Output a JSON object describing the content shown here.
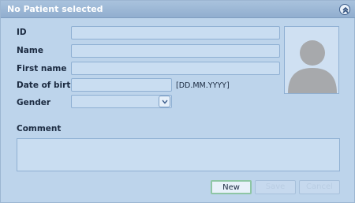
{
  "window": {
    "title": "No Patient selected"
  },
  "form": {
    "id_label": "ID",
    "name_label": "Name",
    "first_name_label": "First name",
    "dob_label": "Date of birth",
    "dob_format_hint": "[DD.MM.YYYY]",
    "gender_label": "Gender",
    "comment_label": "Comment",
    "id_value": "",
    "name_value": "",
    "first_name_value": "",
    "dob_value": "",
    "gender_value": "",
    "comment_value": ""
  },
  "buttons": {
    "new_label": "New",
    "save_label": "Save",
    "cancel_label": "Cancel"
  },
  "icons": {
    "collapse": "double-chevron-up-icon",
    "gender_dropdown": "chevron-down-icon",
    "photo": "person-silhouette-icon"
  }
}
